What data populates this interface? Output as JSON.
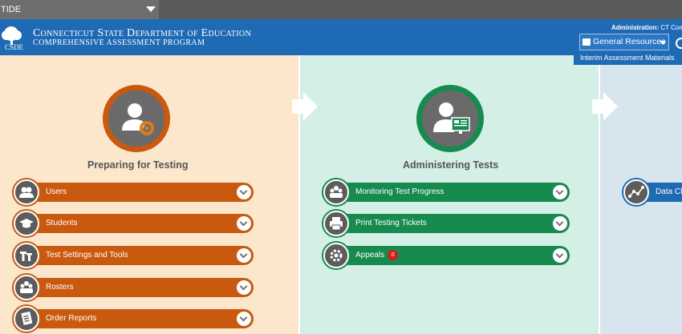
{
  "topbar": {
    "system_label": "TIDE"
  },
  "header": {
    "org_name": "Connecticut State Department of Education",
    "program": "Comprehensive Assessment Program",
    "logo_text": "CSDE",
    "admin_prefix": "Administration:",
    "admin_value": "CT Com",
    "resources_label": "General Resources",
    "resources_menu_item": "Interim Assessment Materials"
  },
  "sections": {
    "preparing": {
      "title": "Preparing for Testing",
      "color": "#c9590f",
      "items": [
        {
          "label": "Users",
          "icon": "users-icon"
        },
        {
          "label": "Students",
          "icon": "graduation-cap-icon"
        },
        {
          "label": "Test Settings and Tools",
          "icon": "tools-icon"
        },
        {
          "label": "Rosters",
          "icon": "rosters-icon"
        },
        {
          "label": "Order Reports",
          "icon": "report-icon"
        }
      ]
    },
    "administering": {
      "title": "Administering Tests",
      "color": "#168a4f",
      "items": [
        {
          "label": "Monitoring Test Progress",
          "icon": "monitor-icon"
        },
        {
          "label": "Print Testing Tickets",
          "icon": "printer-icon"
        },
        {
          "label": "Appeals",
          "icon": "appeals-icon",
          "badge": "0"
        }
      ]
    },
    "after": {
      "color": "#1f6ab4",
      "items": [
        {
          "label": "Data Cle",
          "icon": "data-chart-icon"
        }
      ]
    }
  }
}
